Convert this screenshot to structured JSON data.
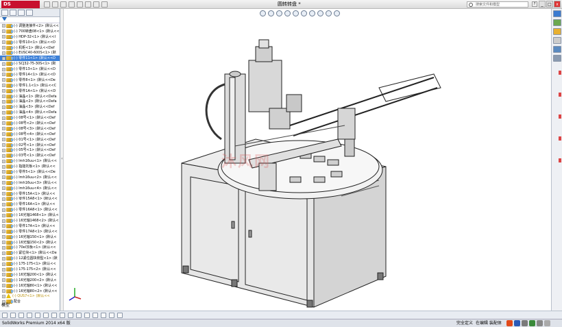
{
  "app": {
    "logo_text": "DS SOLIDWORKS",
    "document_title": "圆转转盘 *",
    "search_placeholder": "搜索文件和模型",
    "help_labels": [
      "?",
      "▾"
    ],
    "window_buttons": [
      "_",
      "□",
      "x"
    ]
  },
  "toolbar": {
    "icons": [
      "new-icon",
      "open-icon",
      "save-icon",
      "print-icon",
      "undo-icon",
      "select-icon",
      "rebuild-icon",
      "options-icon"
    ]
  },
  "heads_up": {
    "icons": [
      "zoom-fit-icon",
      "zoom-area-icon",
      "previous-view-icon",
      "section-view-icon",
      "view-orientation-icon",
      "display-style-icon",
      "hide-show-icon",
      "edit-appearance-icon",
      "apply-scene-icon",
      "view-settings-icon"
    ]
  },
  "tree": {
    "items": [
      {
        "label": "(-) 调整连接件<2> (默认<<",
        "selected": false,
        "warn": false
      },
      {
        "label": "(-) 700转盘08<1> (默认<<",
        "selected": false,
        "warn": false
      },
      {
        "label": "(-) HDP-32<1> (默认<<I",
        "selected": false,
        "warn": false
      },
      {
        "label": "(-) 零件10<1> (默认<<D",
        "selected": false,
        "warn": false
      },
      {
        "label": "(-) 机柜<1> (默认<<Def",
        "selected": false,
        "warn": false
      },
      {
        "label": "(-) EUSC40-600S<1> (默",
        "selected": false,
        "warn": false
      },
      {
        "label": "(-) 零件11<1> (默认<<D",
        "selected": true,
        "warn": false
      },
      {
        "label": "(-) SCJ32-75-30S<1> (默",
        "selected": false,
        "warn": false
      },
      {
        "label": "(-) 零件13<1> (默认<<D",
        "selected": false,
        "warn": false
      },
      {
        "label": "(-) 零件14<1> (默认<<D",
        "selected": false,
        "warn": false
      },
      {
        "label": "(-) 零件8<1> (默认<<De",
        "selected": false,
        "warn": false
      },
      {
        "label": "(-) 零件1.1<1> (默认<<C",
        "selected": false,
        "warn": false
      },
      {
        "label": "(-) 零件1A<1> (默认<<D",
        "selected": false,
        "warn": false
      },
      {
        "label": "(-) 油晶<1> (默认<<Defa",
        "selected": false,
        "warn": false
      },
      {
        "label": "(-) 油晶<2> (默认<<Defa",
        "selected": false,
        "warn": false
      },
      {
        "label": "(-) 油晶<3> (默认<<Def",
        "selected": false,
        "warn": false
      },
      {
        "label": "(-) 油晶<4> (默认<<Defa",
        "selected": false,
        "warn": false
      },
      {
        "label": "(-) 08号<1> (默认<<Def",
        "selected": false,
        "warn": false
      },
      {
        "label": "(-) 08号<2> (默认<<Def",
        "selected": false,
        "warn": false
      },
      {
        "label": "(-) 08号<3> (默认<<Def",
        "selected": false,
        "warn": false
      },
      {
        "label": "(-) 08号<4> (默认<<Def",
        "selected": false,
        "warn": false
      },
      {
        "label": "(-) 01号<1> (默认<<Def",
        "selected": false,
        "warn": false
      },
      {
        "label": "(-) 02号<1> (默认<<Def",
        "selected": false,
        "warn": false
      },
      {
        "label": "(-) 05号<1> (默认<<Def",
        "selected": false,
        "warn": false
      },
      {
        "label": "(-) 03号<1> (默认<<Def",
        "selected": false,
        "warn": false
      },
      {
        "label": "(-) lmh16uu<1> (默认<<",
        "selected": false,
        "warn": false
      },
      {
        "label": "(-) 指能托板<1> (默认<<",
        "selected": false,
        "warn": false
      },
      {
        "label": "(-) 零件5<1> (默认<<De",
        "selected": false,
        "warn": false
      },
      {
        "label": "(-) lmh16uu<2> (默认<<",
        "selected": false,
        "warn": false
      },
      {
        "label": "(-) lmh16uu<3> (默认<<",
        "selected": false,
        "warn": false
      },
      {
        "label": "(-) lmh16uu<4> (默认<<",
        "selected": false,
        "warn": false
      },
      {
        "label": "(-) 零件15A<1> (默认<<",
        "selected": false,
        "warn": false
      },
      {
        "label": "(-) 零件15A8<1> (默认<<",
        "selected": false,
        "warn": false
      },
      {
        "label": "(-) 零件16A<1> (默认<<",
        "selected": false,
        "warn": false
      },
      {
        "label": "(-) 零件16A8<1> (默认<<",
        "selected": false,
        "warn": false
      },
      {
        "label": "(-) 16光轴1468<1> (默认<",
        "selected": false,
        "warn": false
      },
      {
        "label": "(-) 16光轴1468<2> (默认<",
        "selected": false,
        "warn": false
      },
      {
        "label": "(-) 零件17A<1> (默认<<",
        "selected": false,
        "warn": false
      },
      {
        "label": "(-) 零件17A8<1> (默认<<",
        "selected": false,
        "warn": false
      },
      {
        "label": "(-) 16光轴150<1> (默认<",
        "selected": false,
        "warn": false
      },
      {
        "label": "(-) 16光轴150<2> (默认<",
        "selected": false,
        "warn": false
      },
      {
        "label": "(-) 70el顶板<1> (默认<<",
        "selected": false,
        "warn": false
      },
      {
        "label": "(-) 紧位块<1> (默认<<De",
        "selected": false,
        "warn": false
      },
      {
        "label": "(-) 12紧位圆块侧型<1> (默",
        "selected": false,
        "warn": false
      },
      {
        "label": "(-) 175-175<1> (默认<<",
        "selected": false,
        "warn": false
      },
      {
        "label": "(-) 175-175<2> (默认<<",
        "selected": false,
        "warn": false
      },
      {
        "label": "(-) 16光轴200<1> (默认<",
        "selected": false,
        "warn": false
      },
      {
        "label": "(-) 16光轴200<2> (默认<",
        "selected": false,
        "warn": false
      },
      {
        "label": "(-) 16光轴80<1> (默认<<",
        "selected": false,
        "warn": false
      },
      {
        "label": "(-) 16光轴80<2> (默认<<",
        "selected": false,
        "warn": false
      },
      {
        "label": "(-) QUS7<1> (默认<<",
        "selected": false,
        "warn": true
      },
      {
        "label": "配合",
        "selected": false,
        "warn": false
      }
    ]
  },
  "viewport": {
    "watermark": "沐风网",
    "panel_grip": "‹"
  },
  "bottom": {
    "model_tab": "模型"
  },
  "status": {
    "app_name": "SolidWorks Premium 2014 x64 版",
    "definition": "完全定义",
    "editing": "在编辑  装配体"
  },
  "colors": {
    "selection": "#3c80d8",
    "logo": "#c8102e",
    "cabinet": "#e6e6e6",
    "outline": "#222222"
  }
}
